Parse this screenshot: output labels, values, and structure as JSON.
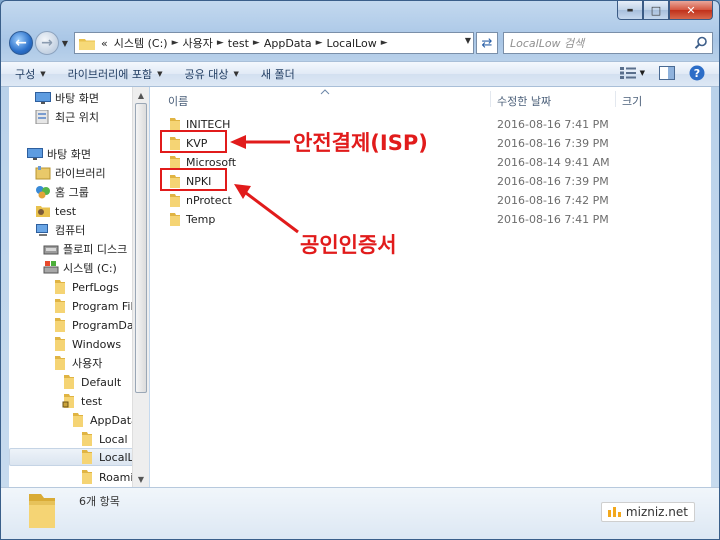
{
  "window": {
    "caption_buttons": {
      "minimize": "▬",
      "maximize": "□",
      "close": "✕"
    }
  },
  "address": {
    "overflow_label": "«",
    "crumbs": [
      "시스템 (C:)",
      "사용자",
      "test",
      "AppData",
      "LocalLow"
    ]
  },
  "search": {
    "placeholder": "LocalLow 검색"
  },
  "toolbar": {
    "organize_label": "구성",
    "include_library_label": "라이브러리에 포함",
    "share_label": "공유 대상",
    "new_folder_label": "새 폴더"
  },
  "sidebar": {
    "items": [
      {
        "label": "바탕 화면",
        "icon": "desktop-icon"
      },
      {
        "label": "최근 위치",
        "icon": "recent-places-icon"
      },
      {
        "label": "바탕 화면",
        "icon": "desktop-icon"
      },
      {
        "label": "라이브러리",
        "icon": "libraries-icon"
      },
      {
        "label": "홈 그룹",
        "icon": "homegroup-icon"
      },
      {
        "label": "test",
        "icon": "user-folder-icon"
      },
      {
        "label": "컴퓨터",
        "icon": "computer-icon"
      },
      {
        "label": "플로피 디스크",
        "icon": "floppy-icon"
      },
      {
        "label": "시스템 (C:)",
        "icon": "drive-icon"
      },
      {
        "label": "PerfLogs",
        "icon": "folder-icon"
      },
      {
        "label": "Program Files",
        "icon": "folder-icon"
      },
      {
        "label": "ProgramData",
        "icon": "folder-icon"
      },
      {
        "label": "Windows",
        "icon": "folder-icon"
      },
      {
        "label": "사용자",
        "icon": "folder-icon"
      },
      {
        "label": "Default",
        "icon": "folder-icon"
      },
      {
        "label": "test",
        "icon": "folder-locked-icon"
      },
      {
        "label": "AppData",
        "icon": "folder-icon"
      },
      {
        "label": "Local",
        "icon": "folder-icon"
      },
      {
        "label": "LocalLow",
        "icon": "folder-icon"
      },
      {
        "label": "Roaming",
        "icon": "folder-icon"
      }
    ]
  },
  "columns": {
    "name": "이름",
    "modified": "수정한 날짜",
    "size": "크기"
  },
  "files": [
    {
      "name": "INITECH",
      "modified": "2016-08-16 7:41 PM"
    },
    {
      "name": "KVP",
      "modified": "2016-08-16 7:39 PM"
    },
    {
      "name": "Microsoft",
      "modified": "2016-08-14 9:41 AM"
    },
    {
      "name": "NPKI",
      "modified": "2016-08-16 7:39 PM"
    },
    {
      "name": "nProtect",
      "modified": "2016-08-16 7:42 PM"
    },
    {
      "name": "Temp",
      "modified": "2016-08-16 7:41 PM"
    }
  ],
  "annotations": {
    "kvp": "안전결제(ISP)",
    "npki": "공인인증서",
    "color": "#e11b1b"
  },
  "details": {
    "item_count": "6개 항목"
  },
  "watermark": {
    "text": "mizniz.net"
  }
}
